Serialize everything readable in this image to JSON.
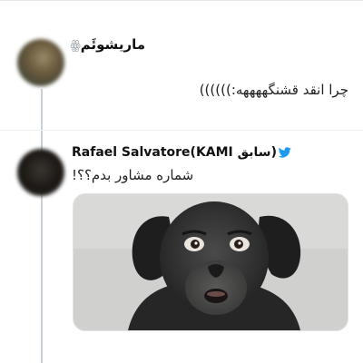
{
  "tweet1": {
    "display_name": "ماریشوئَم",
    "name_glyph": "ꙮ",
    "text": "چرا انقد قشنگههههه:))))))"
  },
  "tweet2": {
    "display_name": "Rafael Salvatore(KAMI سابق)",
    "text": "شماره مشاور بدم؟؟!",
    "media": {
      "subject-icon": "dog-with-human-face"
    }
  },
  "colors": {
    "thread_line": "#c9d0d6",
    "verified_blue": "#1d9bf0",
    "text": "#222222"
  }
}
